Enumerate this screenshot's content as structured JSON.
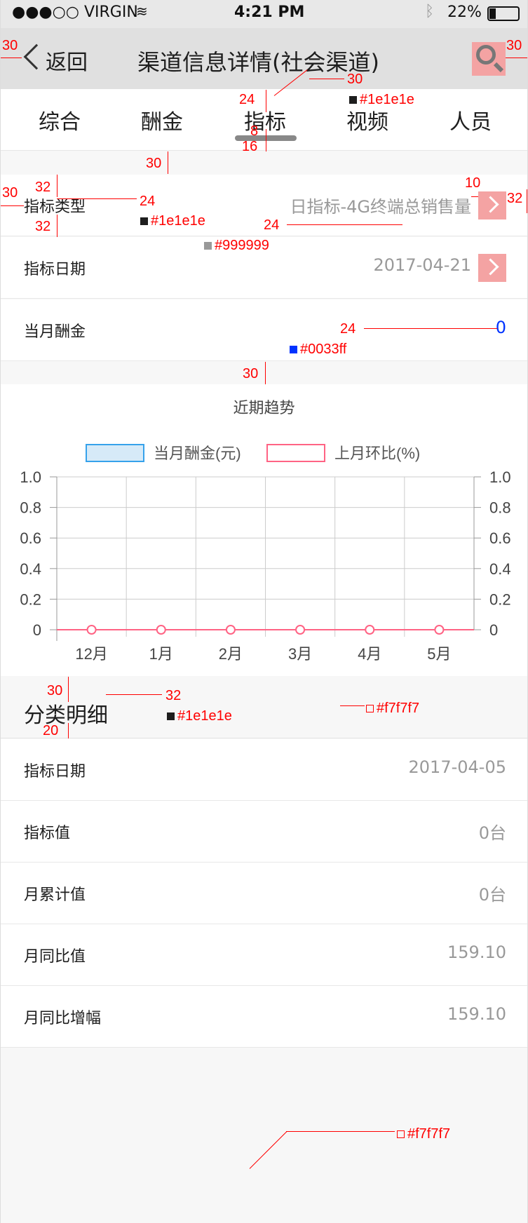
{
  "status_bar": {
    "carrier": "●●●○○ VIRGIN",
    "time": "4:21 PM",
    "battery": "22%"
  },
  "nav": {
    "back_label": "返回",
    "title": "渠道信息详情(社会渠道)"
  },
  "tabs": [
    "综合",
    "酬金",
    "指标",
    "视频",
    "人员"
  ],
  "active_tab": 2,
  "info_rows": [
    {
      "label": "指标类型",
      "value": "日指标-4G终端总销售量"
    },
    {
      "label": "指标日期",
      "value": "2017-04-21"
    },
    {
      "label": "当月酬金",
      "value": "0"
    }
  ],
  "chart_data": {
    "type": "line",
    "title": "近期趋势",
    "categories": [
      "12月",
      "1月",
      "2月",
      "3月",
      "4月",
      "5月"
    ],
    "series": [
      {
        "name": "当月酬金(元)",
        "values": [
          0,
          0,
          0,
          0,
          0,
          0
        ],
        "color": "#36a2eb"
      },
      {
        "name": "上月环比(%)",
        "values": [
          0,
          0,
          0,
          0,
          0,
          0
        ],
        "color": "#ff6384"
      }
    ],
    "y_left_ticks": [
      "1.0",
      "0.8",
      "0.6",
      "0.4",
      "0.2",
      "0"
    ],
    "y_right_ticks": [
      "1.0",
      "0.8",
      "0.6",
      "0.4",
      "0.2",
      "0"
    ],
    "ylim": [
      0,
      1
    ],
    "legend": "top",
    "grid": true
  },
  "section": {
    "title": "分类明细"
  },
  "detail_rows": [
    {
      "label": "指标日期",
      "value": "2017-04-05"
    },
    {
      "label": "指标值",
      "value": "0台"
    },
    {
      "label": "月累计值",
      "value": "0台"
    },
    {
      "label": "月同比值",
      "value": "159.10"
    },
    {
      "label": "月同比增幅",
      "value": "159.10"
    }
  ],
  "annotations": {
    "n30": "30",
    "n24": "24",
    "n32": "32",
    "n8": "8",
    "n16": "16",
    "n10": "10",
    "n20": "20",
    "c1e": "#1e1e1e",
    "c999": "#999999",
    "c00f": "#0033ff",
    "cf7": "#f7f7f7"
  },
  "colors": {
    "link_blue": "#0033ff",
    "text_dark": "#1e1e1e",
    "text_gray": "#999999",
    "bg": "#f7f7f7"
  }
}
